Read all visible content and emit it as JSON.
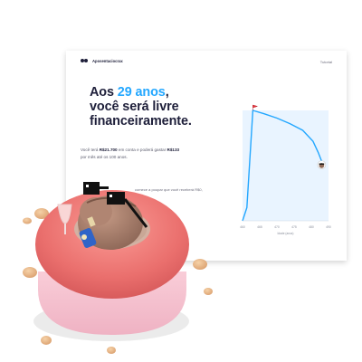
{
  "brand": {
    "name": "Aposentaciocrax",
    "logo_icon": "sunglasses-logo-icon"
  },
  "header": {
    "link_label": "Tutorial"
  },
  "headline": {
    "line1_prefix": "Aos ",
    "age_highlight": "29 anos",
    "line1_suffix": ",",
    "line2": "você será livre",
    "line3": "financeiramente."
  },
  "summary": {
    "text_before_total": "Você terá ",
    "total_amount": "R$21.700",
    "text_between": " em conta e poderá gastar ",
    "monthly_amount": "R$133",
    "text_after": " por mês até os 100 anos."
  },
  "footnote": {
    "text": "comece a poupar que você receberá R$0,"
  },
  "chart_data": {
    "type": "line",
    "x_tick_labels": [
      "460",
      "465",
      "470",
      "475",
      "480",
      "490"
    ],
    "xlabel": "Idade (anos)",
    "points": [
      {
        "x": 0.0,
        "y": 0
      },
      {
        "x": 0.05,
        "y": 12
      },
      {
        "x": 0.12,
        "y": 100
      },
      {
        "x": 0.25,
        "y": 97
      },
      {
        "x": 0.4,
        "y": 93
      },
      {
        "x": 0.55,
        "y": 88
      },
      {
        "x": 0.7,
        "y": 82
      },
      {
        "x": 0.82,
        "y": 72
      },
      {
        "x": 0.88,
        "y": 62
      },
      {
        "x": 0.92,
        "y": 54
      }
    ],
    "ylim": [
      0,
      100
    ],
    "line_color": "#23a7ff",
    "start_marker": "red-flag-icon",
    "end_marker": "avatar-marker-icon"
  },
  "colors": {
    "accent": "#23a7ff",
    "heading": "#1e1f3a",
    "donut_pink": "#f07875",
    "donut_base": "#f8c3cf"
  },
  "illustration": {
    "icon": "mascot-in-pool-float-icon"
  }
}
